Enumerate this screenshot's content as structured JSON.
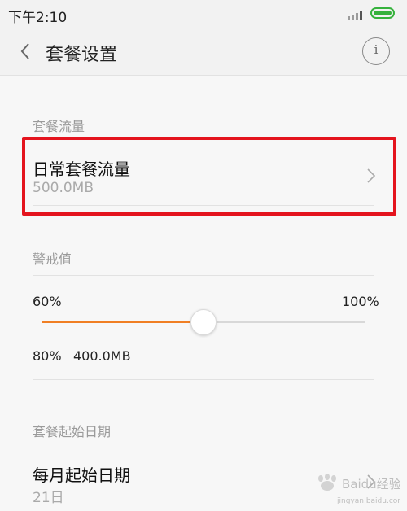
{
  "status_bar": {
    "time": "下午2:10",
    "battery_color": "#35b23c"
  },
  "header": {
    "title": "套餐设置",
    "back_icon": "chevron-left-icon",
    "info_icon": "info-icon"
  },
  "plan_section": {
    "header": "套餐流量",
    "item": {
      "title": "日常套餐流量",
      "value": "500.0MB"
    }
  },
  "warning_section": {
    "header": "警戒值",
    "slider": {
      "min_label": "60%",
      "max_label": "100%",
      "value_percent": 80,
      "value_label": "80%",
      "value_amount": "400.0MB",
      "accent_color": "#f07f24"
    }
  },
  "start_date_section": {
    "header": "套餐起始日期",
    "item": {
      "title": "每月起始日期",
      "value": "21日"
    }
  },
  "annotation": {
    "highlight_color": "#e4141e"
  },
  "watermark": {
    "text": "Baidu经验",
    "sub": "jingyan.baidu.com"
  }
}
